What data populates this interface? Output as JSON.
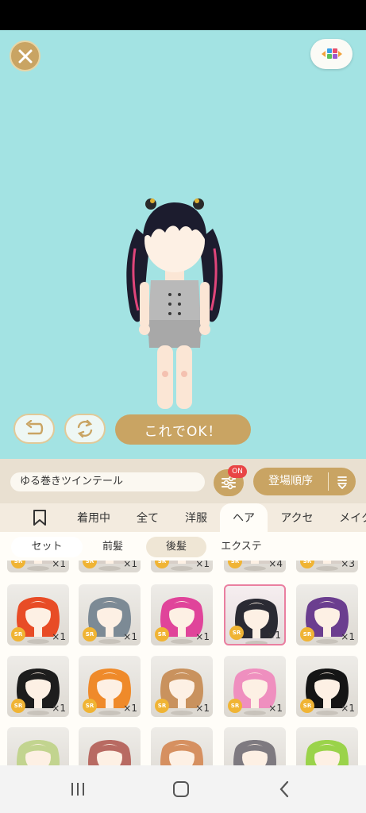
{
  "controls": {
    "confirm_label": "これでOK！"
  },
  "item": {
    "name": "ゆる巻きツインテール"
  },
  "filter": {
    "badge": "ON"
  },
  "sort": {
    "label": "登場順序"
  },
  "tabs": [
    {
      "label": "着用中"
    },
    {
      "label": "全て"
    },
    {
      "label": "洋服"
    },
    {
      "label": "ヘア"
    },
    {
      "label": "アクセ"
    },
    {
      "label": "メイク"
    }
  ],
  "subtabs": [
    {
      "label": "セット"
    },
    {
      "label": "前髪"
    },
    {
      "label": "後髪"
    },
    {
      "label": "エクステ"
    }
  ],
  "top_partial_counts": [
    "×1",
    "×1",
    "×1",
    "×4",
    "×3"
  ],
  "grid": [
    {
      "rarity": "SR",
      "count": "×1",
      "hair": "#e84c26"
    },
    {
      "rarity": "SR",
      "count": "×1",
      "hair": "#7c8a95"
    },
    {
      "rarity": "SR",
      "count": "×1",
      "hair": "#e0449a"
    },
    {
      "rarity": "SR",
      "count": "×1",
      "hair": "#2a2a33"
    },
    {
      "rarity": "SR",
      "count": "×1",
      "hair": "#6b3e8f"
    },
    {
      "rarity": "SR",
      "count": "×1",
      "hair": "#1d1d1d"
    },
    {
      "rarity": "SR",
      "count": "×1",
      "hair": "#ef8a2a"
    },
    {
      "rarity": "SR",
      "count": "×1",
      "hair": "#c9925e"
    },
    {
      "rarity": "SR",
      "count": "×1",
      "hair": "#ef8fbf"
    },
    {
      "rarity": "SR",
      "count": "×1",
      "hair": "#151515"
    }
  ],
  "bottom_partial_hair": [
    "#c2d48f",
    "#b86a62",
    "#d69060",
    "#7e7a80",
    "#9ad34a"
  ],
  "colors": {
    "stage": "#a3e3e3",
    "gold": "#c9a463",
    "badge_red": "#e94545",
    "rarity": "#f0b434",
    "selected_border": "#ea7fa0"
  }
}
